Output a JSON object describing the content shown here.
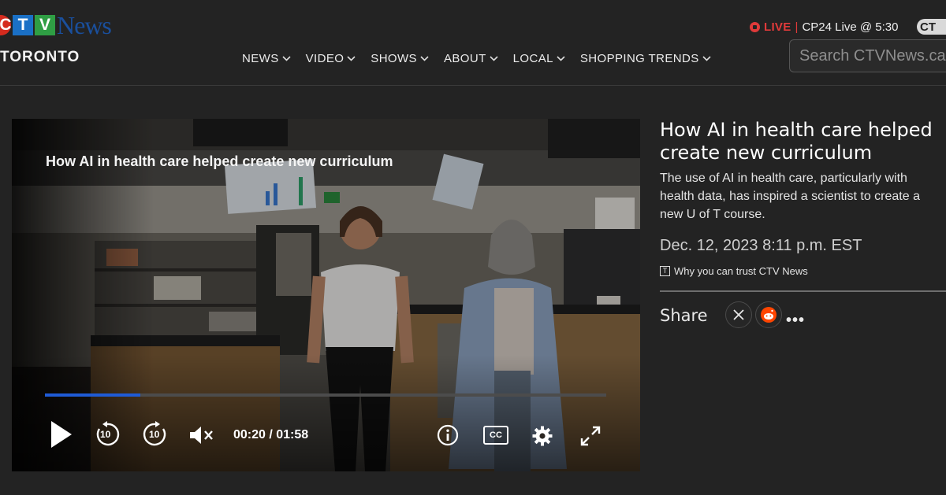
{
  "header": {
    "logo": {
      "letters": [
        "C",
        "T",
        "V"
      ],
      "word": "News"
    },
    "region": "TORONTO",
    "nav": [
      {
        "label": "NEWS"
      },
      {
        "label": "VIDEO"
      },
      {
        "label": "SHOWS"
      },
      {
        "label": "ABOUT"
      },
      {
        "label": "LOCAL"
      },
      {
        "label": "SHOPPING TRENDS"
      }
    ],
    "live": {
      "label": "LIVE",
      "separator": "|",
      "text": "CP24 Live @ 5:30"
    },
    "badge": "CT",
    "search_placeholder": "Search CTVNews.ca"
  },
  "video": {
    "overlay_title": "How AI in health care helped create new curriculum",
    "progress": 0.17,
    "time": "00:20 / 01:58",
    "rewind_seconds": "10",
    "forward_seconds": "10",
    "cc_label": "CC"
  },
  "article": {
    "title": "How AI in health care helped create new curriculum",
    "description": "The use of AI in health care, particularly with health data, has inspired a scientist to create a new U of T course.",
    "date": "Dec. 12, 2023 8:11 p.m. EST",
    "trust_link": "Why you can trust CTV News",
    "share_label": "Share",
    "more": "•••"
  },
  "colors": {
    "accent_live": "#e03a3a",
    "progress": "#1f5bd6",
    "background": "#232323"
  }
}
